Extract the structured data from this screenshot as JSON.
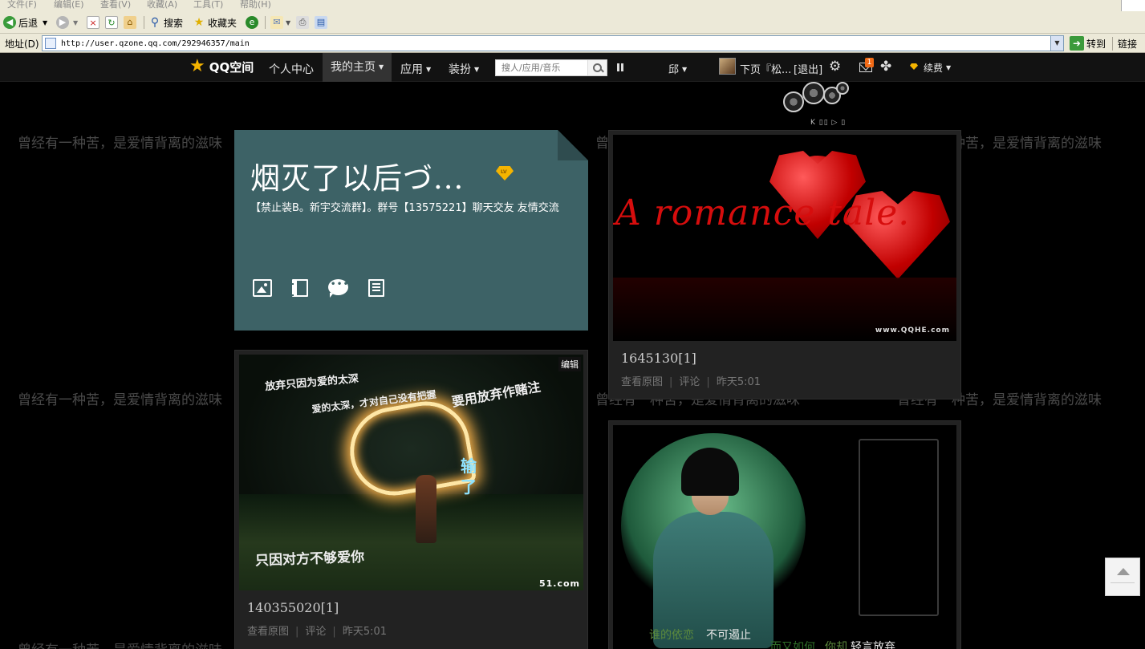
{
  "browser": {
    "menu": [
      "文件(F)",
      "编辑(E)",
      "查看(V)",
      "收藏(A)",
      "工具(T)",
      "帮助(H)"
    ],
    "toolbar": {
      "back": "后退",
      "search": "搜索",
      "favorites": "收藏夹"
    },
    "address_label": "地址(D)",
    "url": "http://user.qzone.qq.com/292946357/main",
    "go": "转到",
    "links": "链接"
  },
  "navbar": {
    "logo": "QQ空间",
    "items": [
      "个人中心",
      "我的主页",
      "应用",
      "装扮"
    ],
    "search_placeholder": "搜人/应用/音乐",
    "user_short": "邱",
    "user_name": "下页『松...",
    "logout": "[退出]",
    "mail_count": "1",
    "renew": "续费"
  },
  "background_text": "曾经有一种苦，是爱情背离的滋味",
  "music_widget": "K ▯▯ ▷ ▯",
  "profile": {
    "title": "烟灭了以后づ...",
    "vip_badge": "LV",
    "description": "【禁止装B。新宇交流群】。群号【13575221】聊天交友 友情交流"
  },
  "feed": [
    {
      "id": "1645130[1]",
      "view_original": "查看原图",
      "comment": "评论",
      "time": "昨天5:01",
      "image_text": "A romance tale.",
      "watermark": "www.QQHE.com"
    },
    {
      "id": "140355020[1]",
      "view_original": "查看原图",
      "comment": "评论",
      "time": "昨天5:01",
      "edit": "编辑",
      "image_lines": [
        "放弃只因为爱的太深",
        "爱的太深，才对自己没有把握",
        "要用放弃作赌注",
        "输了",
        "只因对方不够爱你"
      ],
      "watermark": "51.com"
    },
    {
      "caption_1": "谁的依恋",
      "caption_2": "不可遏止",
      "caption_3": "而又如何",
      "caption_4": "你却",
      "caption_5": "轻言放弃"
    }
  ],
  "colors": {
    "profile_card": "#3d6266",
    "navbar": "#121212",
    "accent": "#f5b400"
  }
}
